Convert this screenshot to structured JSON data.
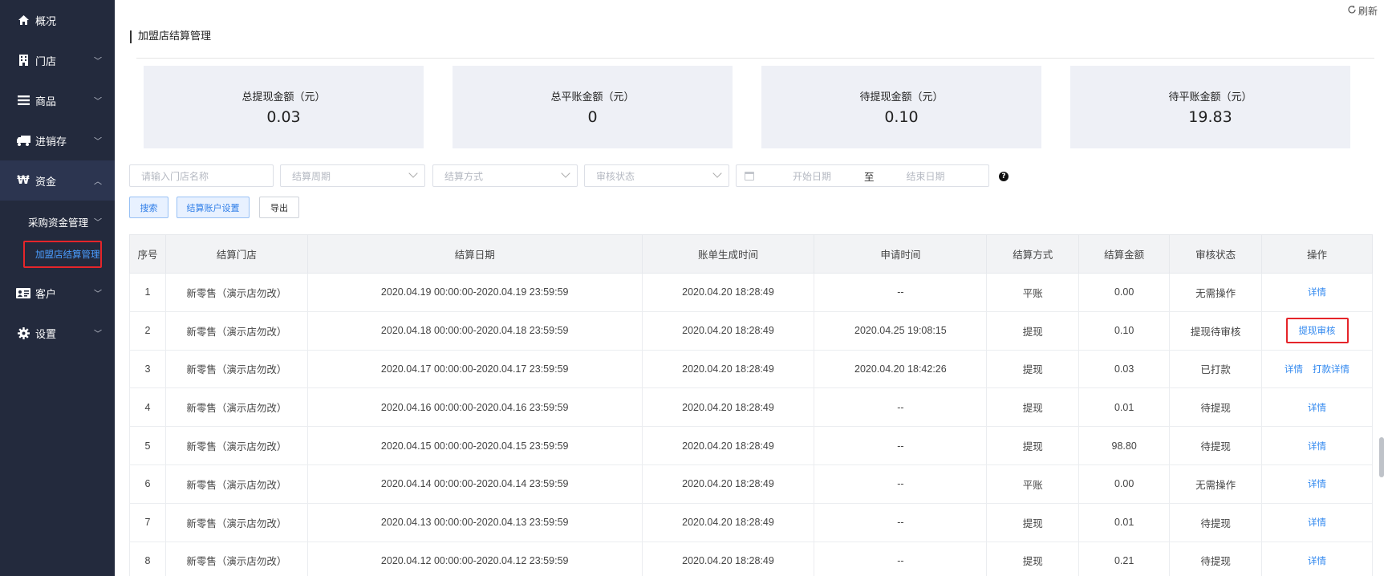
{
  "sidebar": {
    "items": [
      {
        "label": "概况",
        "icon": "home-icon",
        "has_chevron": false
      },
      {
        "label": "门店",
        "icon": "building-icon",
        "has_chevron": true
      },
      {
        "label": "商品",
        "icon": "list-icon",
        "has_chevron": true
      },
      {
        "label": "进销存",
        "icon": "truck-icon",
        "has_chevron": true
      },
      {
        "label": "资金",
        "icon": "won-icon",
        "has_chevron": true,
        "expanded": true
      },
      {
        "label": "客户",
        "icon": "id-card-icon",
        "has_chevron": true
      },
      {
        "label": "设置",
        "icon": "gear-icon",
        "has_chevron": true
      }
    ],
    "sub_items": [
      {
        "label": "采购资金管理",
        "has_chevron": true
      },
      {
        "label": "加盟店结算管理",
        "selected": true
      }
    ]
  },
  "header": {
    "refresh_label": "刷新",
    "page_title": "加盟店结算管理"
  },
  "stats": [
    {
      "label": "总提现金额（元）",
      "value": "0.03"
    },
    {
      "label": "总平账金额（元）",
      "value": "0"
    },
    {
      "label": "待提现金额（元）",
      "value": "0.10"
    },
    {
      "label": "待平账金额（元）",
      "value": "19.83"
    }
  ],
  "filters": {
    "store_name_placeholder": "请输入门店名称",
    "cycle_placeholder": "结算周期",
    "method_placeholder": "结算方式",
    "status_placeholder": "审核状态",
    "start_date_placeholder": "开始日期",
    "to_label": "至",
    "end_date_placeholder": "结束日期"
  },
  "buttons": {
    "search": "搜索",
    "account_settings": "结算账户设置",
    "export": "导出"
  },
  "table": {
    "columns": [
      "序号",
      "结算门店",
      "结算日期",
      "账单生成时间",
      "申请时间",
      "结算方式",
      "结算金额",
      "审核状态",
      "操作"
    ],
    "rows": [
      {
        "no": "1",
        "store": "新零售（演示店勿改）",
        "period": "2020.04.19 00:00:00-2020.04.19 23:59:59",
        "generated": "2020.04.20 18:28:49",
        "applied": "--",
        "method": "平账",
        "amount": "0.00",
        "status": "无需操作",
        "ops": [
          "详情"
        ]
      },
      {
        "no": "2",
        "store": "新零售（演示店勿改）",
        "period": "2020.04.18 00:00:00-2020.04.18 23:59:59",
        "generated": "2020.04.20 18:28:49",
        "applied": "2020.04.25 19:08:15",
        "method": "提现",
        "amount": "0.10",
        "status": "提现待审核",
        "ops": [
          "提现审核"
        ],
        "op_highlight": true
      },
      {
        "no": "3",
        "store": "新零售（演示店勿改）",
        "period": "2020.04.17 00:00:00-2020.04.17 23:59:59",
        "generated": "2020.04.20 18:28:49",
        "applied": "2020.04.20 18:42:26",
        "method": "提现",
        "amount": "0.03",
        "status": "已打款",
        "ops": [
          "详情",
          "打款详情"
        ]
      },
      {
        "no": "4",
        "store": "新零售（演示店勿改）",
        "period": "2020.04.16 00:00:00-2020.04.16 23:59:59",
        "generated": "2020.04.20 18:28:49",
        "applied": "--",
        "method": "提现",
        "amount": "0.01",
        "status": "待提现",
        "ops": [
          "详情"
        ]
      },
      {
        "no": "5",
        "store": "新零售（演示店勿改）",
        "period": "2020.04.15 00:00:00-2020.04.15 23:59:59",
        "generated": "2020.04.20 18:28:49",
        "applied": "--",
        "method": "提现",
        "amount": "98.80",
        "status": "待提现",
        "ops": [
          "详情"
        ]
      },
      {
        "no": "6",
        "store": "新零售（演示店勿改）",
        "period": "2020.04.14 00:00:00-2020.04.14 23:59:59",
        "generated": "2020.04.20 18:28:49",
        "applied": "--",
        "method": "平账",
        "amount": "0.00",
        "status": "无需操作",
        "ops": [
          "详情"
        ]
      },
      {
        "no": "7",
        "store": "新零售（演示店勿改）",
        "period": "2020.04.13 00:00:00-2020.04.13 23:59:59",
        "generated": "2020.04.20 18:28:49",
        "applied": "--",
        "method": "提现",
        "amount": "0.01",
        "status": "待提现",
        "ops": [
          "详情"
        ]
      },
      {
        "no": "8",
        "store": "新零售（演示店勿改）",
        "period": "2020.04.12 00:00:00-2020.04.12 23:59:59",
        "generated": "2020.04.20 18:28:49",
        "applied": "--",
        "method": "提现",
        "amount": "0.21",
        "status": "待提现",
        "ops": [
          "详情"
        ]
      }
    ]
  },
  "colors": {
    "sidebar_bg": "#232a3d",
    "accent": "#2f87ef",
    "highlight_box": "#e5252a"
  }
}
